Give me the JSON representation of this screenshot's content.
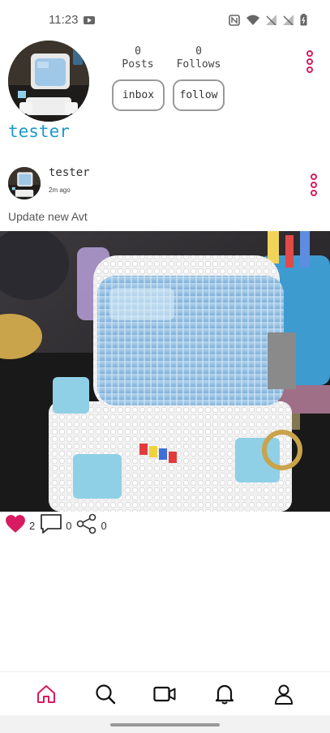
{
  "status_bar": {
    "time": "11:23",
    "icons": [
      "youtube-icon",
      "nfc-icon",
      "wifi-icon",
      "signal-1-icon",
      "signal-2-icon",
      "battery-icon"
    ]
  },
  "profile": {
    "username": "tester",
    "posts_count": "0",
    "posts_label": "Posts",
    "follows_count": "0",
    "follows_label": "Follows",
    "inbox_label": "inbox",
    "follow_label": "follow"
  },
  "post": {
    "author": "tester",
    "time": "2m ago",
    "caption": "Update new Avt",
    "likes": "2",
    "comments": "0",
    "shares": "0",
    "liked": true
  },
  "nav": {
    "items": [
      "home-icon",
      "search-icon",
      "video-icon",
      "bell-icon",
      "profile-icon"
    ],
    "active": "home-icon"
  },
  "colors": {
    "accent": "#d81b60",
    "username": "#1a9bc9",
    "pill_border": "#9a9a9a"
  }
}
